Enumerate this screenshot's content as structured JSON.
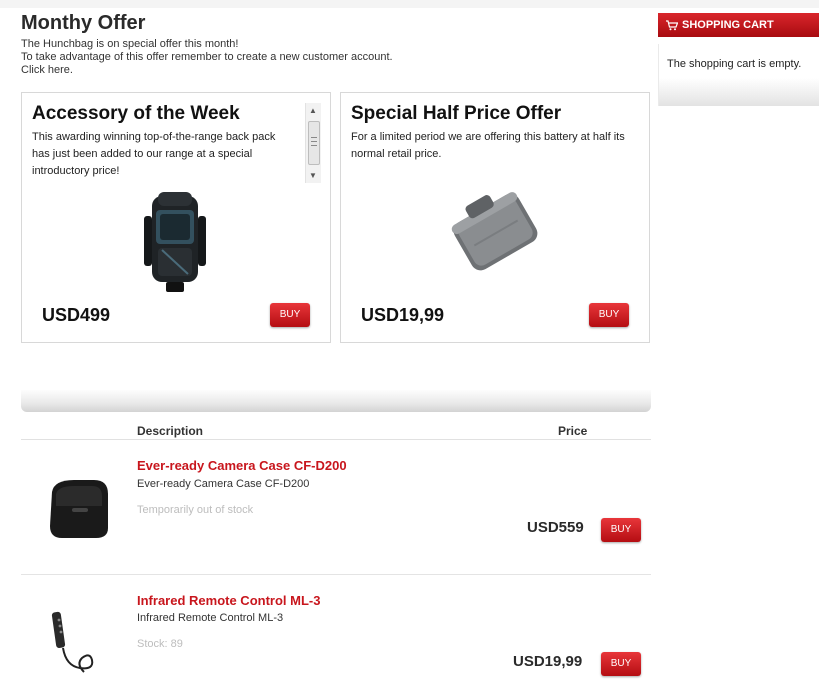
{
  "offer": {
    "title": "Monthy Offer",
    "line1": "The Hunchbag is on special offer this month!",
    "line2": "To take advantage of this offer remember to create a new customer account.",
    "line3": "Click here."
  },
  "accessory": {
    "title": "Accessory of the Week",
    "description": "This awarding winning top-of-the-range back pack has just been added to our range at a special introductory price!",
    "price": "USD499",
    "buy_label": "BUY"
  },
  "half_price": {
    "title": "Special Half Price Offer",
    "description": "For a limited period we are offering this battery at half its normal retail price.",
    "price": "USD19,99",
    "buy_label": "BUY"
  },
  "table": {
    "col_description": "Description",
    "col_price": "Price"
  },
  "products": [
    {
      "name": "Ever-ready Camera Case CF-D200",
      "subtitle": "Ever-ready Camera Case CF-D200",
      "stock": "Temporarily out of stock",
      "price": "USD559",
      "buy_label": "BUY"
    },
    {
      "name": "Infrared Remote Control ML-3",
      "subtitle": "Infrared Remote Control ML-3",
      "stock": "Stock:  89",
      "price": "USD19,99",
      "buy_label": "BUY"
    }
  ],
  "cart": {
    "title": "SHOPPING CART",
    "empty_text": "The shopping cart is empty.",
    "icon": "cart-icon"
  },
  "colors": {
    "accent_red": "#c8161d",
    "button_red": "#d0191f"
  }
}
